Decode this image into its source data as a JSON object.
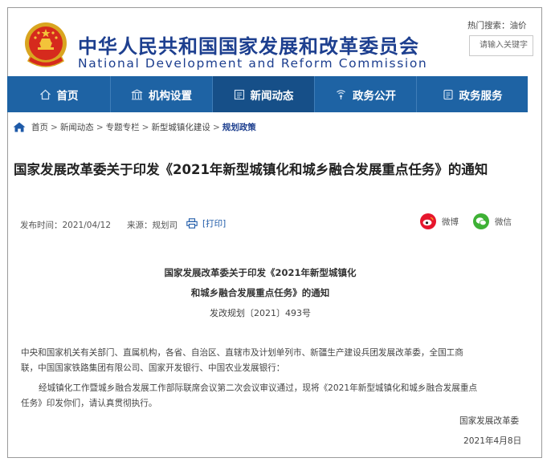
{
  "header": {
    "title_cn": "中华人民共和国国家发展和改革委员会",
    "title_en": "National Development and Reform Commission",
    "hot_search_label": "热门搜索：",
    "hot_search_term": "油价",
    "search_placeholder": "请输入关键字"
  },
  "nav": {
    "items": [
      {
        "label": "首页",
        "icon": "home-icon"
      },
      {
        "label": "机构设置",
        "icon": "building-icon"
      },
      {
        "label": "新闻动态",
        "icon": "news-icon"
      },
      {
        "label": "政务公开",
        "icon": "broadcast-icon"
      },
      {
        "label": "政务服务",
        "icon": "service-icon"
      }
    ],
    "active": "新闻动态",
    "accent": "#1e63a4"
  },
  "breadcrumb": {
    "items": [
      "首页",
      "新闻动态",
      "专题专栏",
      "新型城镇化建设"
    ],
    "current": "规划政策",
    "separator": ">"
  },
  "article": {
    "headline": "国家发展改革委关于印发《2021年新型城镇化和城乡融合发展重点任务》的通知",
    "publish_label": "发布时间：",
    "publish_date": "2021/04/12",
    "source_label": "来源：",
    "source": "规划司",
    "print_label": "[打印]",
    "share_weibo": "微博",
    "share_wechat": "微信",
    "doc_title_line1": "国家发展改革委关于印发《2021年新型城镇化",
    "doc_title_line2": "和城乡融合发展重点任务》的通知",
    "doc_number": "发改规划〔2021〕493号",
    "addressee_line1": "中央和国家机关有关部门、直属机构，各省、自治区、直辖市及计划单列市、新疆生产建设兵团发展改革委，全国工商",
    "addressee_line2": "联，中国国家铁路集团有限公司、国家开发银行、中国农业发展银行：",
    "body_line1": "经城镇化工作暨城乡融合发展工作部际联席会议第二次会议审议通过，现将《2021年新型城镇化和城乡融合发展重点",
    "body_line2": "任务》印发你们，请认真贯彻执行。",
    "signature": "国家发展改革委",
    "sign_date": "2021年4月8日"
  }
}
